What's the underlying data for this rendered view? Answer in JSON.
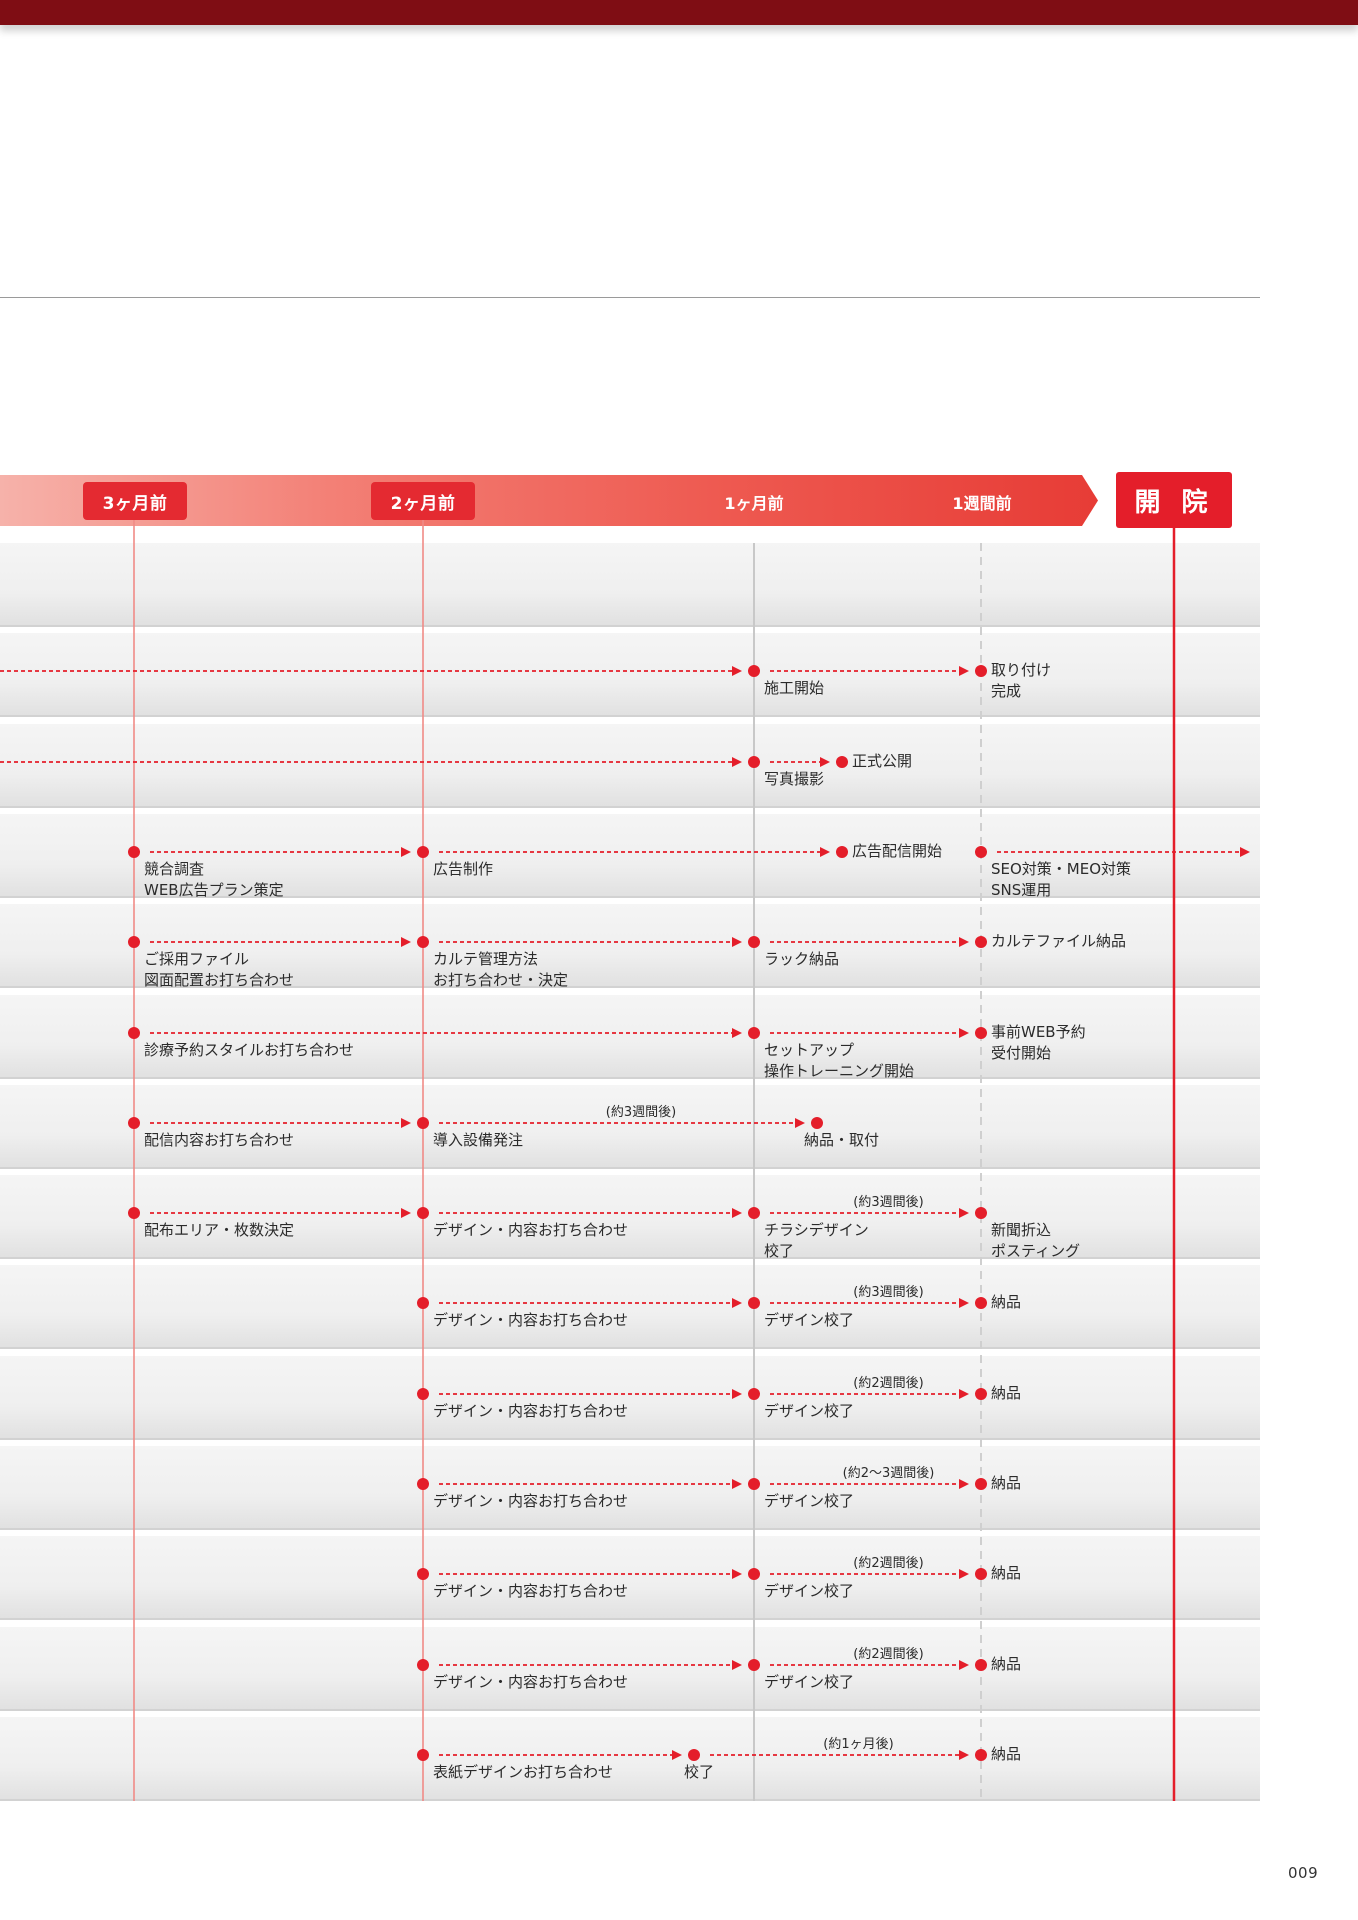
{
  "colors": {
    "top_bar": "#7f0d14",
    "accent": "#e41e2a",
    "dot": "#e41e2a",
    "dashed_arrow": "#e41e2a",
    "row_bg": "#efefef",
    "milestone_line": "#f08a86",
    "month_line": "#c8c8c8",
    "week_line": "#cfcfcf"
  },
  "header": {
    "milestones": [
      {
        "label": "3ヶ月前",
        "style": "pill"
      },
      {
        "label": "2ヶ月前",
        "style": "pill"
      },
      {
        "label": "1ヶ月前",
        "style": "text"
      },
      {
        "label": "1週間前",
        "style": "text"
      }
    ],
    "opening": "開 院"
  },
  "rows": [
    {
      "events": []
    },
    {
      "events": [
        {
          "type": "arrow",
          "from": "left",
          "to": "1m"
        },
        {
          "type": "dot",
          "at": "1m"
        },
        {
          "type": "label",
          "at": "1m",
          "text": "施工開始"
        },
        {
          "type": "arrow",
          "from": "1m",
          "to": "1w"
        },
        {
          "type": "dot",
          "at": "1w"
        },
        {
          "type": "label",
          "at": "1w",
          "text": "取り付け\n完成",
          "top": true
        }
      ]
    },
    {
      "events": [
        {
          "type": "arrow",
          "from": "left",
          "to": "1m"
        },
        {
          "type": "dot",
          "at": "1m"
        },
        {
          "type": "label",
          "at": "1m",
          "text": "写真撮影"
        },
        {
          "type": "arrow",
          "from": "1m",
          "to": "m3w"
        },
        {
          "type": "dot",
          "at": "m3w"
        },
        {
          "type": "label",
          "at": "m3w",
          "text": "正式公開",
          "top": true
        }
      ]
    },
    {
      "events": [
        {
          "type": "dot",
          "at": "3m"
        },
        {
          "type": "label",
          "at": "3m",
          "text": "競合調査\nWEB広告プラン策定"
        },
        {
          "type": "arrow",
          "from": "3m",
          "to": "2m"
        },
        {
          "type": "dot",
          "at": "2m"
        },
        {
          "type": "label",
          "at": "2m",
          "text": "広告制作"
        },
        {
          "type": "arrow",
          "from": "2m",
          "to": "m3w"
        },
        {
          "type": "dot",
          "at": "m3w"
        },
        {
          "type": "label",
          "at": "m3w",
          "text": "広告配信開始",
          "top": true
        },
        {
          "type": "dot",
          "at": "1w"
        },
        {
          "type": "label",
          "at": "1w",
          "text": "SEO対策・MEO対策\nSNS運用"
        },
        {
          "type": "arrow",
          "from": "1w",
          "to": "right"
        }
      ]
    },
    {
      "events": [
        {
          "type": "dot",
          "at": "3m"
        },
        {
          "type": "label",
          "at": "3m",
          "text": "ご採用ファイル\n図面配置お打ち合わせ"
        },
        {
          "type": "arrow",
          "from": "3m",
          "to": "2m"
        },
        {
          "type": "dot",
          "at": "2m"
        },
        {
          "type": "label",
          "at": "2m",
          "text": "カルテ管理方法\nお打ち合わせ・決定"
        },
        {
          "type": "arrow",
          "from": "2m",
          "to": "1m"
        },
        {
          "type": "dot",
          "at": "1m"
        },
        {
          "type": "label",
          "at": "1m",
          "text": "ラック納品"
        },
        {
          "type": "arrow",
          "from": "1m",
          "to": "1w"
        },
        {
          "type": "dot",
          "at": "1w"
        },
        {
          "type": "label",
          "at": "1w",
          "text": "カルテファイル納品",
          "top": true
        }
      ]
    },
    {
      "events": [
        {
          "type": "dot",
          "at": "3m"
        },
        {
          "type": "label",
          "at": "3m",
          "text": "診療予約スタイルお打ち合わせ"
        },
        {
          "type": "arrow",
          "from": "3m",
          "to": "1m"
        },
        {
          "type": "dot",
          "at": "1m"
        },
        {
          "type": "label",
          "at": "1m",
          "text": "セットアップ\n操作トレーニング開始"
        },
        {
          "type": "arrow",
          "from": "1m",
          "to": "1w"
        },
        {
          "type": "dot",
          "at": "1w"
        },
        {
          "type": "label",
          "at": "1w",
          "text": "事前WEB予約\n受付開始",
          "top": true
        }
      ]
    },
    {
      "events": [
        {
          "type": "dot",
          "at": "3m"
        },
        {
          "type": "label",
          "at": "3m",
          "text": "配信内容お打ち合わせ"
        },
        {
          "type": "arrow",
          "from": "3m",
          "to": "2m"
        },
        {
          "type": "dot",
          "at": "2m"
        },
        {
          "type": "label",
          "at": "2m",
          "text": "導入設備発注"
        },
        {
          "type": "arrow",
          "from": "2m",
          "to": "m3wb",
          "note": "(約3週間後)"
        },
        {
          "type": "dot",
          "at": "m3wb"
        },
        {
          "type": "label",
          "at": "m3wb",
          "text": "納品・取付",
          "offset": -13
        }
      ]
    },
    {
      "events": [
        {
          "type": "dot",
          "at": "3m"
        },
        {
          "type": "label",
          "at": "3m",
          "text": "配布エリア・枚数決定"
        },
        {
          "type": "arrow",
          "from": "3m",
          "to": "2m"
        },
        {
          "type": "dot",
          "at": "2m"
        },
        {
          "type": "label",
          "at": "2m",
          "text": "デザイン・内容お打ち合わせ"
        },
        {
          "type": "arrow",
          "from": "2m",
          "to": "1m"
        },
        {
          "type": "dot",
          "at": "1m"
        },
        {
          "type": "label",
          "at": "1m",
          "text": "チラシデザイン\n校了"
        },
        {
          "type": "arrow",
          "from": "1m",
          "to": "1w",
          "note": "(約3週間後)"
        },
        {
          "type": "dot",
          "at": "1w"
        },
        {
          "type": "label",
          "at": "1w",
          "text": "新聞折込\nポスティング"
        }
      ]
    },
    {
      "events": [
        {
          "type": "dot",
          "at": "2m"
        },
        {
          "type": "label",
          "at": "2m",
          "text": "デザイン・内容お打ち合わせ"
        },
        {
          "type": "arrow",
          "from": "2m",
          "to": "1m"
        },
        {
          "type": "dot",
          "at": "1m"
        },
        {
          "type": "label",
          "at": "1m",
          "text": "デザイン校了"
        },
        {
          "type": "arrow",
          "from": "1m",
          "to": "1w",
          "note": "(約3週間後)"
        },
        {
          "type": "dot",
          "at": "1w"
        },
        {
          "type": "label",
          "at": "1w",
          "text": "納品",
          "top": true
        }
      ]
    },
    {
      "events": [
        {
          "type": "dot",
          "at": "2m"
        },
        {
          "type": "label",
          "at": "2m",
          "text": "デザイン・内容お打ち合わせ"
        },
        {
          "type": "arrow",
          "from": "2m",
          "to": "1m"
        },
        {
          "type": "dot",
          "at": "1m"
        },
        {
          "type": "label",
          "at": "1m",
          "text": "デザイン校了"
        },
        {
          "type": "arrow",
          "from": "1m",
          "to": "1w",
          "note": "(約2週間後)"
        },
        {
          "type": "dot",
          "at": "1w"
        },
        {
          "type": "label",
          "at": "1w",
          "text": "納品",
          "top": true
        }
      ]
    },
    {
      "events": [
        {
          "type": "dot",
          "at": "2m"
        },
        {
          "type": "label",
          "at": "2m",
          "text": "デザイン・内容お打ち合わせ"
        },
        {
          "type": "arrow",
          "from": "2m",
          "to": "1m"
        },
        {
          "type": "dot",
          "at": "1m"
        },
        {
          "type": "label",
          "at": "1m",
          "text": "デザイン校了"
        },
        {
          "type": "arrow",
          "from": "1m",
          "to": "1w",
          "note": "(約2〜3週間後)"
        },
        {
          "type": "dot",
          "at": "1w"
        },
        {
          "type": "label",
          "at": "1w",
          "text": "納品",
          "top": true
        }
      ]
    },
    {
      "events": [
        {
          "type": "dot",
          "at": "2m"
        },
        {
          "type": "label",
          "at": "2m",
          "text": "デザイン・内容お打ち合わせ"
        },
        {
          "type": "arrow",
          "from": "2m",
          "to": "1m"
        },
        {
          "type": "dot",
          "at": "1m"
        },
        {
          "type": "label",
          "at": "1m",
          "text": "デザイン校了"
        },
        {
          "type": "arrow",
          "from": "1m",
          "to": "1w",
          "note": "(約2週間後)"
        },
        {
          "type": "dot",
          "at": "1w"
        },
        {
          "type": "label",
          "at": "1w",
          "text": "納品",
          "top": true
        }
      ]
    },
    {
      "events": [
        {
          "type": "dot",
          "at": "2m"
        },
        {
          "type": "label",
          "at": "2m",
          "text": "デザイン・内容お打ち合わせ"
        },
        {
          "type": "arrow",
          "from": "2m",
          "to": "1m"
        },
        {
          "type": "dot",
          "at": "1m"
        },
        {
          "type": "label",
          "at": "1m",
          "text": "デザイン校了"
        },
        {
          "type": "arrow",
          "from": "1m",
          "to": "1w",
          "note": "(約2週間後)"
        },
        {
          "type": "dot",
          "at": "1w"
        },
        {
          "type": "label",
          "at": "1w",
          "text": "納品",
          "top": true
        }
      ]
    },
    {
      "events": [
        {
          "type": "dot",
          "at": "2m"
        },
        {
          "type": "label",
          "at": "2m",
          "text": "表紙デザインお打ち合わせ"
        },
        {
          "type": "arrow",
          "from": "2m",
          "to": "m5w"
        },
        {
          "type": "dot",
          "at": "m5w"
        },
        {
          "type": "label",
          "at": "m5w",
          "text": "校了",
          "offset": -10
        },
        {
          "type": "arrow",
          "from": "m5w",
          "to": "1w",
          "note": "(約1ヶ月後)"
        },
        {
          "type": "dot",
          "at": "1w"
        },
        {
          "type": "label",
          "at": "1w",
          "text": "納品",
          "top": true
        }
      ]
    }
  ],
  "page_number": "009"
}
